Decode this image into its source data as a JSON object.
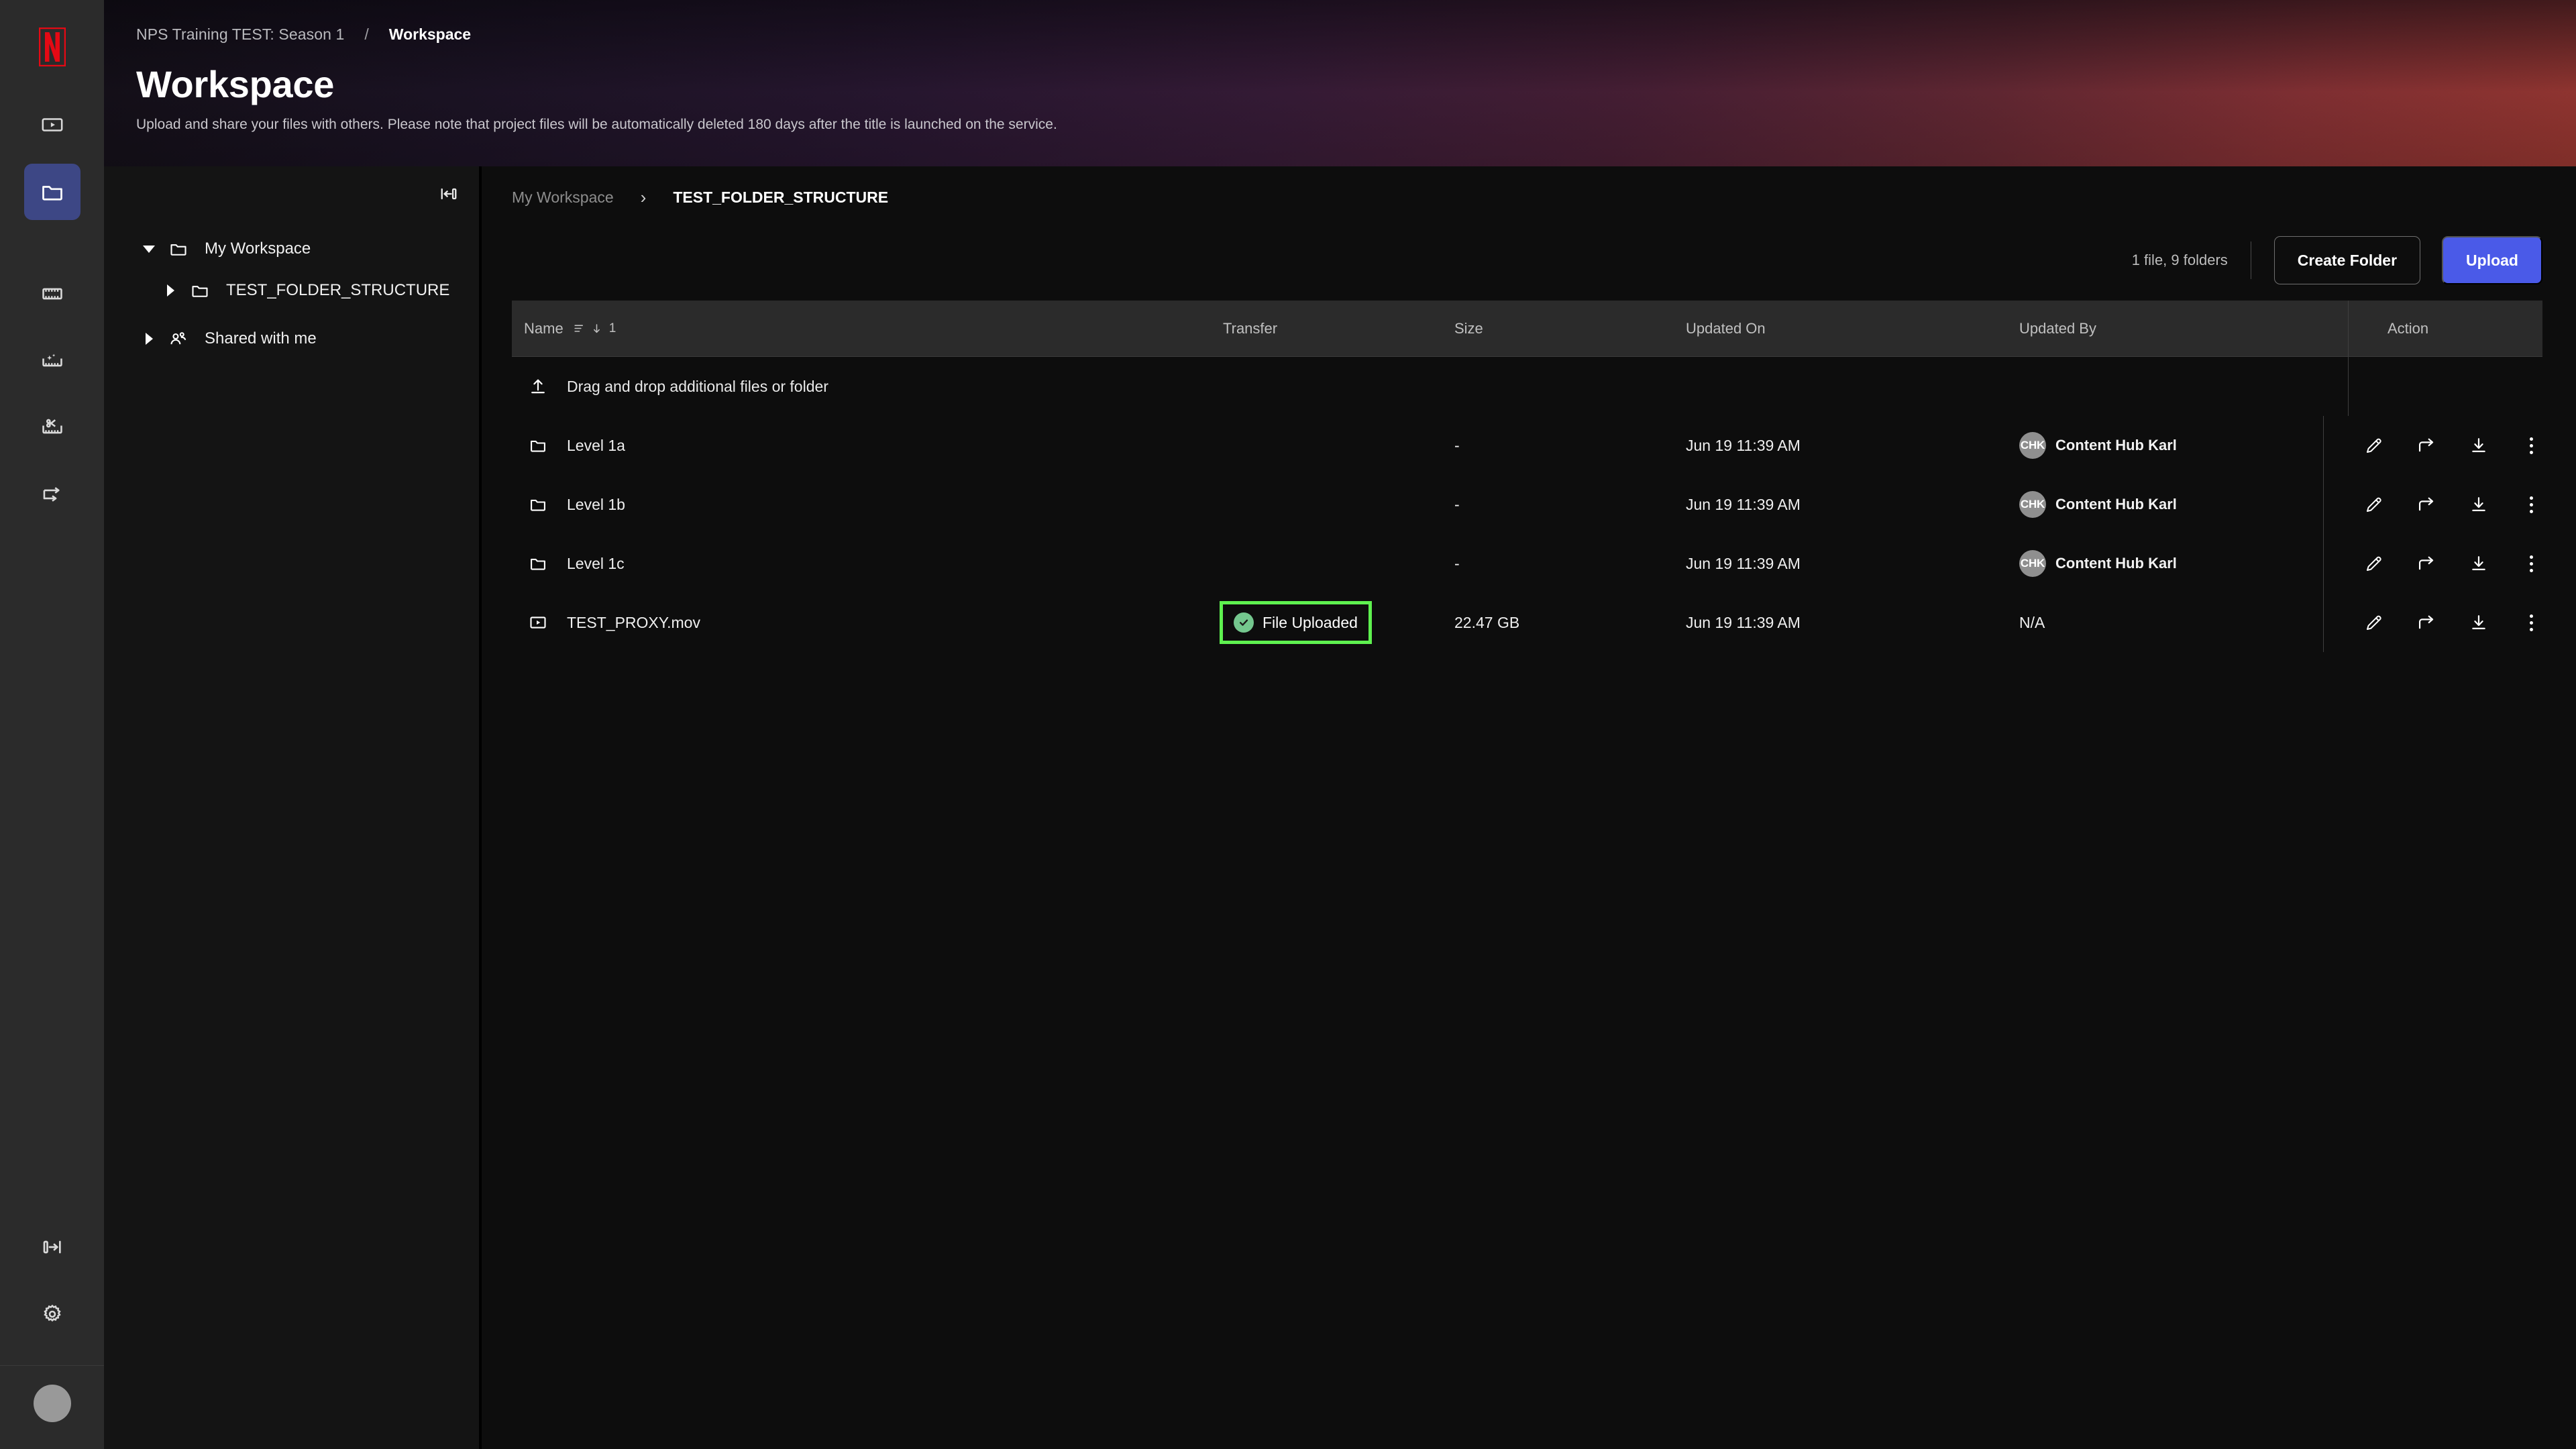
{
  "app": {
    "brand_logo": "netflix-n-logo",
    "accent_primary": "#4a5ae8",
    "highlight_color": "#5ef14f",
    "status_color": "#74c78e"
  },
  "rail": {
    "items": [
      {
        "name": "video-player-icon",
        "label": "Player"
      },
      {
        "name": "folder-icon",
        "label": "Workspace",
        "active": true
      },
      {
        "name": "film-strip-icon",
        "label": "Media"
      },
      {
        "name": "film-strip-sparkle-icon",
        "label": "Highlights"
      },
      {
        "name": "film-strip-scissors-icon",
        "label": "Edit"
      },
      {
        "name": "transfer-arrow-icon",
        "label": "Transfer"
      }
    ],
    "bottom": [
      {
        "name": "expand-panel-icon",
        "label": "Expand"
      },
      {
        "name": "gear-icon",
        "label": "Settings"
      }
    ],
    "avatar": ""
  },
  "header": {
    "breadcrumb_title": "NPS Training TEST: Season 1",
    "breadcrumb_separator": "/",
    "breadcrumb_current": "Workspace",
    "page_title": "Workspace",
    "subtitle": "Upload and share your files with others. Please note that project files will be automatically deleted 180 days after the title is launched on the service."
  },
  "tree": {
    "collapse_icon": "collapse-panel-left-icon",
    "nodes": [
      {
        "label": "My Workspace",
        "icon": "folder-icon",
        "caret": "down",
        "indent": false
      },
      {
        "label": "TEST_FOLDER_STRUCTURE",
        "icon": "folder-icon",
        "caret": "right",
        "indent": true
      },
      {
        "label": "Shared with me",
        "icon": "people-icon",
        "caret": "right",
        "indent": false
      }
    ]
  },
  "main": {
    "breadcrumb": [
      {
        "label": "My Workspace",
        "current": false
      },
      {
        "label": "TEST_FOLDER_STRUCTURE",
        "current": true
      }
    ],
    "breadcrumb_chevron": "›",
    "count_text": "1 file, 9 folders",
    "create_folder_label": "Create Folder",
    "upload_label": "Upload",
    "table": {
      "columns": [
        {
          "key": "name",
          "label": "Name",
          "sort_icon": "sort-descending-icon",
          "sort_order": "1"
        },
        {
          "key": "transfer",
          "label": "Transfer"
        },
        {
          "key": "size",
          "label": "Size"
        },
        {
          "key": "updated_on",
          "label": "Updated On"
        },
        {
          "key": "updated_by",
          "label": "Updated By"
        },
        {
          "key": "action",
          "label": "Action"
        }
      ],
      "dropzone": {
        "icon": "upload-icon",
        "label": "Drag and drop additional files or folder"
      },
      "rows": [
        {
          "icon": "folder-icon",
          "name": "Level 1a",
          "transfer": "",
          "size": "-",
          "updated_on": "Jun 19 11:39 AM",
          "updated_by": "Content Hub Karl",
          "avatar_initials": "CHK",
          "highlighted": false
        },
        {
          "icon": "folder-icon",
          "name": "Level 1b",
          "transfer": "",
          "size": "-",
          "updated_on": "Jun 19 11:39 AM",
          "updated_by": "Content Hub Karl",
          "avatar_initials": "CHK",
          "highlighted": false
        },
        {
          "icon": "folder-icon",
          "name": "Level 1c",
          "transfer": "",
          "size": "-",
          "updated_on": "Jun 19 11:39 AM",
          "updated_by": "Content Hub Karl",
          "avatar_initials": "CHK",
          "highlighted": false
        },
        {
          "icon": "video-file-icon",
          "name": "TEST_PROXY.mov",
          "transfer": "File Uploaded",
          "size": "22.47 GB",
          "updated_on": "Jun 19 11:39 AM",
          "updated_by": "N/A",
          "avatar_initials": "",
          "highlighted": true
        }
      ],
      "row_actions": [
        {
          "name": "edit-pencil-icon",
          "label": "Rename"
        },
        {
          "name": "share-arrow-icon",
          "label": "Share"
        },
        {
          "name": "download-icon",
          "label": "Download"
        },
        {
          "name": "more-options-icon",
          "label": "More"
        }
      ]
    }
  }
}
